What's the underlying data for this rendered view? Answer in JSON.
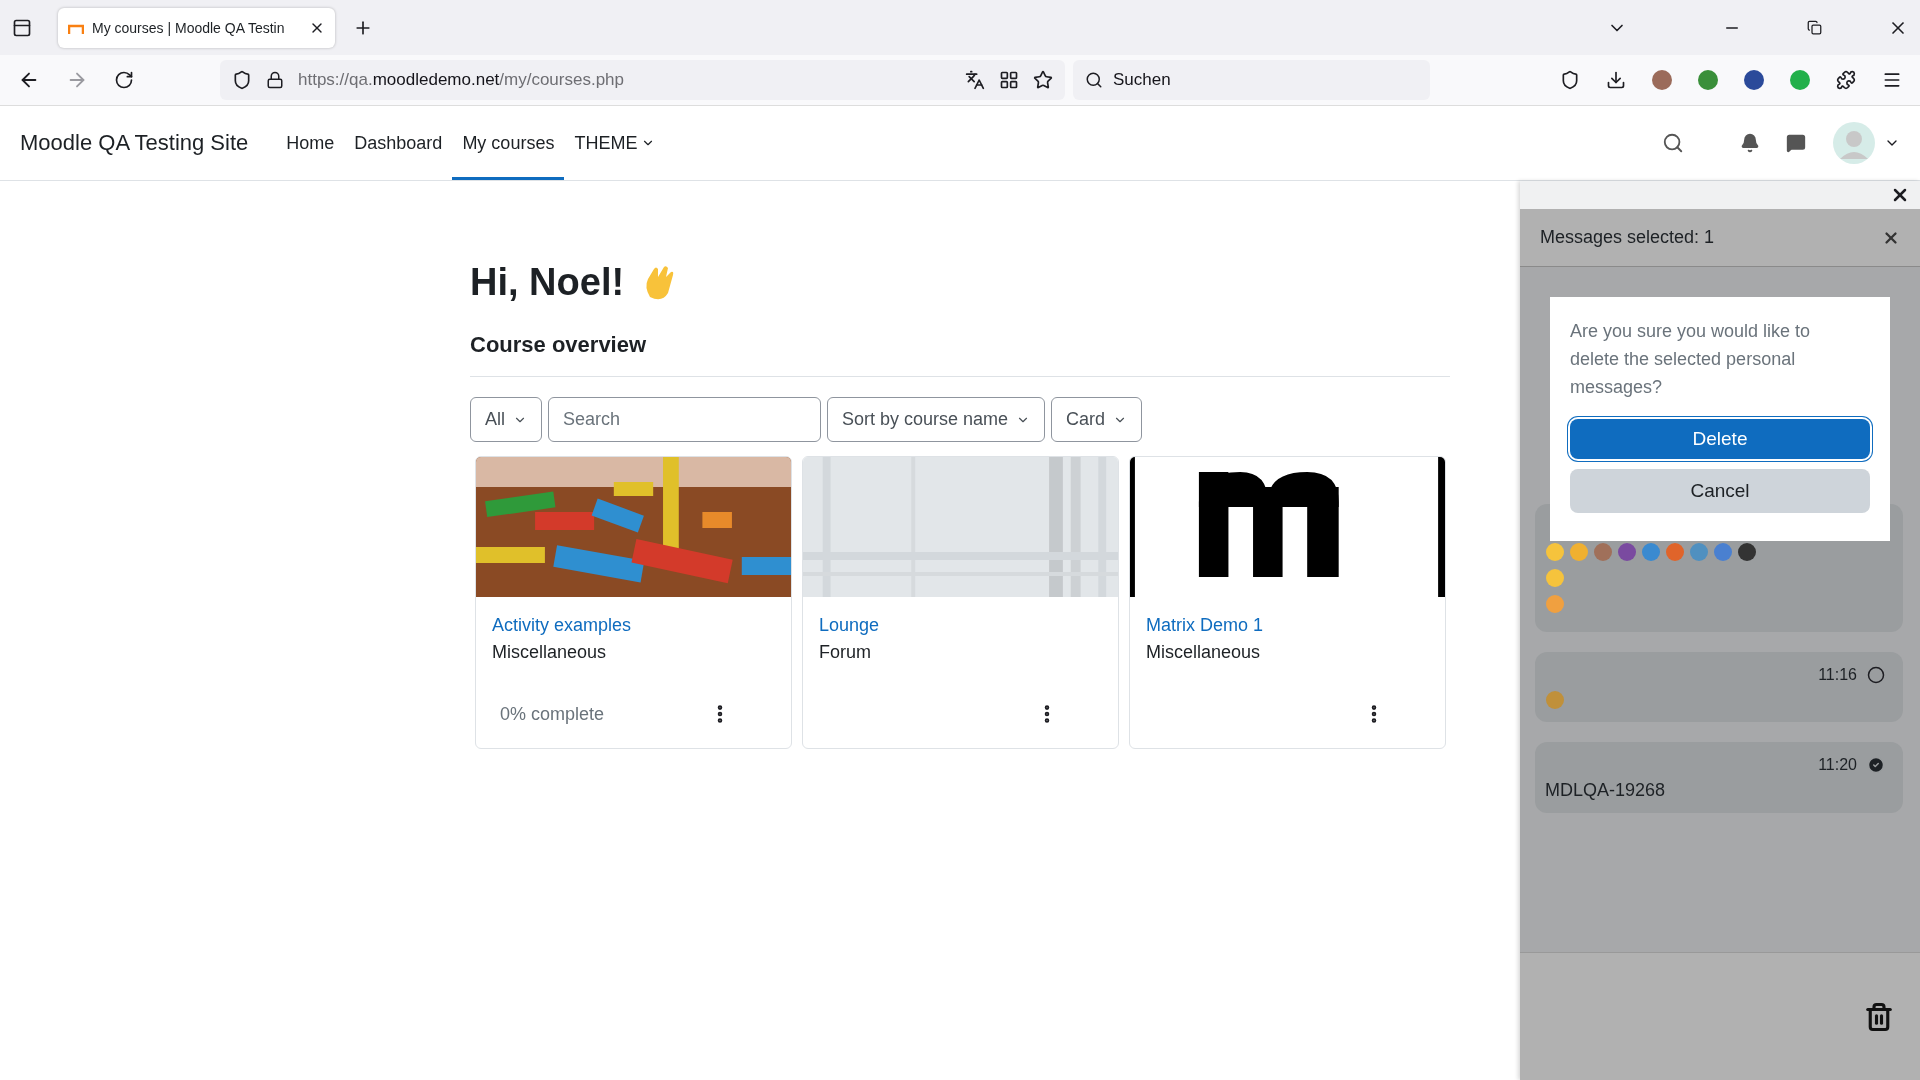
{
  "browser": {
    "tab_title": "My courses | Moodle QA Testin",
    "url_scheme": "https://qa.",
    "url_domain": "moodledemo.net",
    "url_path": "/my/courses.php",
    "search_placeholder": "Suchen"
  },
  "site": {
    "name": "Moodle QA Testing Site",
    "nav": [
      {
        "label": "Home",
        "selected": false,
        "kind": "link"
      },
      {
        "label": "Dashboard",
        "selected": false,
        "kind": "link"
      },
      {
        "label": "My courses",
        "selected": true,
        "kind": "link"
      },
      {
        "label": "THEME",
        "selected": false,
        "kind": "dropdown"
      }
    ]
  },
  "greeting": "Hi, Noel!",
  "section_title": "Course overview",
  "filters": [
    {
      "kind": "select",
      "label": "All"
    },
    {
      "kind": "search",
      "placeholder": "Search"
    },
    {
      "kind": "select",
      "label": "Sort by course name"
    },
    {
      "kind": "select",
      "label": "Card"
    }
  ],
  "courses": [
    {
      "title": "Activity examples",
      "category": "Miscellaneous",
      "progress": "0% complete"
    },
    {
      "title": "Lounge",
      "category": "Forum"
    },
    {
      "title": "Matrix Demo 1",
      "category": "Miscellaneous"
    }
  ],
  "drawer": {
    "header": "Messages selected: 1",
    "messages": [
      {
        "kind": "emoji-rows"
      },
      {
        "kind": "emoji",
        "time": "11:16",
        "selected": false
      },
      {
        "kind": "text",
        "time": "11:20",
        "selected": true,
        "text": "MDLQA-19268"
      }
    ]
  },
  "dialog": {
    "text": "Are you sure you would like to delete the selected personal messages?",
    "buttons": [
      {
        "label": "Delete",
        "kind": "primary",
        "focused": true
      },
      {
        "label": "Cancel",
        "kind": "secondary",
        "focused": false
      }
    ]
  }
}
